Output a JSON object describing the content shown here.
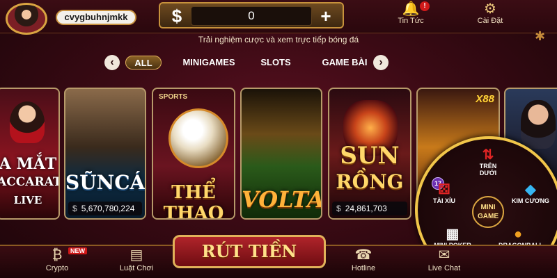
{
  "header": {
    "username": "cvygbuhnjmkk",
    "currency_symbol": "$",
    "balance": "0",
    "plus_symbol": "+",
    "news_label": "Tin Tức",
    "news_badge": "!",
    "settings_label": "Cài Đặt"
  },
  "marquee": "Trải nghiệm cược và xem trực tiếp bóng đá",
  "tabs": {
    "prev": "‹",
    "next": "›",
    "items": [
      {
        "label": "ALL",
        "active": true
      },
      {
        "label": "MINIGAMES",
        "active": false
      },
      {
        "label": "SLOTS",
        "active": false
      },
      {
        "label": "GAME BÀI",
        "active": false
      }
    ]
  },
  "games": [
    {
      "title_line1": "A MẮT",
      "title_line2": "ACCARAT",
      "title_line3": "LIVE"
    },
    {
      "title": "SŨNCÁ",
      "jackpot_symbol": "$",
      "jackpot": "5,670,780,224"
    },
    {
      "tag": "SPORTS",
      "title": "THỂ THAO"
    },
    {
      "title": "VOLTA"
    },
    {
      "title_line1": "SUN",
      "title_line2": "RỒNG",
      "jackpot_symbol": "$",
      "jackpot": "24,861,703"
    },
    {
      "tag": "X88"
    }
  ],
  "minigame": {
    "center_line1": "MINI",
    "center_line2": "GAME",
    "badge": "17",
    "items": [
      {
        "label": "TRÊN DƯỚI"
      },
      {
        "label": "TÀI XỈU"
      },
      {
        "label": "KIM CƯƠNG"
      },
      {
        "label": "MINI POKER"
      },
      {
        "label": "DRAGONBALL"
      }
    ]
  },
  "bottom": {
    "crypto": "Crypto",
    "new_tag": "NEW",
    "rules": "Luật Chơi",
    "withdraw": "RÚT TIỀN",
    "hotline": "Hotline",
    "livechat": "Live Chat"
  }
}
